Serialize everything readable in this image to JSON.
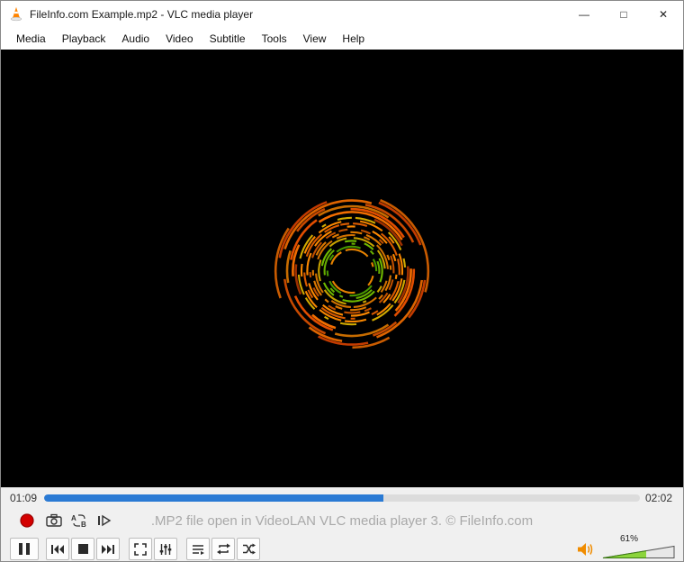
{
  "window": {
    "title": "FileInfo.com Example.mp2 - VLC media player",
    "controls": {
      "minimize": "—",
      "maximize": "□",
      "close": "✕"
    }
  },
  "menu": {
    "items": [
      "Media",
      "Playback",
      "Audio",
      "Video",
      "Subtitle",
      "Tools",
      "View",
      "Help"
    ]
  },
  "seek": {
    "elapsed": "01:09",
    "total": "02:02",
    "progress_pct": 57
  },
  "status": {
    "message": ".MP2 file open in VideoLAN VLC media player 3. © FileInfo.com"
  },
  "volume": {
    "percent_label": "61%",
    "percent": 61
  },
  "colors": {
    "accent_blue": "#2a7ad4",
    "record_red": "#d40000",
    "speaker_orange": "#f08c00",
    "volume_green": "#8cd43c",
    "viz_palette_inner": [
      "#7fd400",
      "#ffd000",
      "#ff9000",
      "#58b800"
    ],
    "viz_palette_mid": [
      "#ff8a00",
      "#ffd000",
      "#7fd400",
      "#ff6a00",
      "#4fae00",
      "#c8e400"
    ],
    "viz_palette_outer": [
      "#e84f00",
      "#ff7300",
      "#c43c00",
      "#ff8a00",
      "#ff5e00"
    ]
  }
}
